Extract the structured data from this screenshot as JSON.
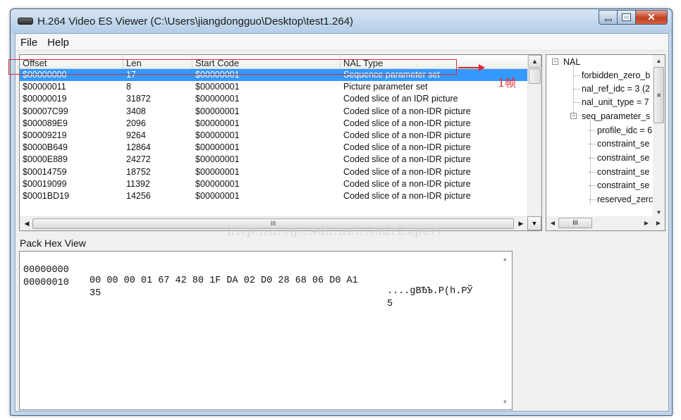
{
  "window": {
    "title": "H.264 Video ES Viewer (C:\\Users\\jiangdongguo\\Desktop\\test1.264)",
    "close_glyph": "✕"
  },
  "menu": [
    "File",
    "Help"
  ],
  "nal_list": {
    "columns": [
      "Offset",
      "Len",
      "Start Code",
      "NAL Type"
    ],
    "rows": [
      {
        "offset": "$00000000",
        "len": "17",
        "start_code": "$00000001",
        "nal_type": "Sequence parameter set",
        "selected": true
      },
      {
        "offset": "$00000011",
        "len": "8",
        "start_code": "$00000001",
        "nal_type": "Picture parameter set"
      },
      {
        "offset": "$00000019",
        "len": "31872",
        "start_code": "$00000001",
        "nal_type": "Coded slice of an IDR picture"
      },
      {
        "offset": "$00007C99",
        "len": "3408",
        "start_code": "$00000001",
        "nal_type": "Coded slice of a non-IDR picture"
      },
      {
        "offset": "$000089E9",
        "len": "2096",
        "start_code": "$00000001",
        "nal_type": "Coded slice of a non-IDR picture"
      },
      {
        "offset": "$00009219",
        "len": "9264",
        "start_code": "$00000001",
        "nal_type": "Coded slice of a non-IDR picture"
      },
      {
        "offset": "$0000B649",
        "len": "12864",
        "start_code": "$00000001",
        "nal_type": "Coded slice of a non-IDR picture"
      },
      {
        "offset": "$0000E889",
        "len": "24272",
        "start_code": "$00000001",
        "nal_type": "Coded slice of a non-IDR picture"
      },
      {
        "offset": "$00014759",
        "len": "18752",
        "start_code": "$00000001",
        "nal_type": "Coded slice of a non-IDR picture"
      },
      {
        "offset": "$00019099",
        "len": "11392",
        "start_code": "$00000001",
        "nal_type": "Coded slice of a non-IDR picture"
      },
      {
        "offset": "$0001BD19",
        "len": "14256",
        "start_code": "$00000001",
        "nal_type": "Coded slice of a non-IDR picture"
      }
    ],
    "hscroll_grip": "III"
  },
  "annotation": {
    "label": "1帧",
    "color": "#e22a2a"
  },
  "tree": {
    "nodes": [
      {
        "label": "NAL",
        "expander": "−"
      },
      {
        "label": "forbidden_zero_b"
      },
      {
        "label": "nal_ref_idc = 3 (2"
      },
      {
        "label": "nal_unit_type = 7"
      },
      {
        "label": "seq_parameter_s",
        "expander": "−"
      },
      {
        "label": "profile_idc = 6"
      },
      {
        "label": "constraint_se"
      },
      {
        "label": "constraint_se"
      },
      {
        "label": "constraint_se"
      },
      {
        "label": "constraint_se"
      },
      {
        "label": "reserved_zerc"
      }
    ],
    "hscroll_grip": "III",
    "vscroll_grip": "≡"
  },
  "watermark": "http://blog.csdn.net/AndrExpert",
  "hex_view": {
    "label": "Pack Hex View",
    "lines": [
      {
        "addr": "00000000",
        "bytes": "00 00 00 01 67 42 80 1F DA 02 D0 28 68 06 D0 A1",
        "ascii": "....gBЂЪ.Р(h.РЎ"
      },
      {
        "addr": "00000010",
        "bytes": "35",
        "ascii": "5"
      }
    ]
  },
  "colors": {
    "selection": "#3399ff",
    "titlebar": "#c4d6ea",
    "close_button": "#c3401f"
  }
}
